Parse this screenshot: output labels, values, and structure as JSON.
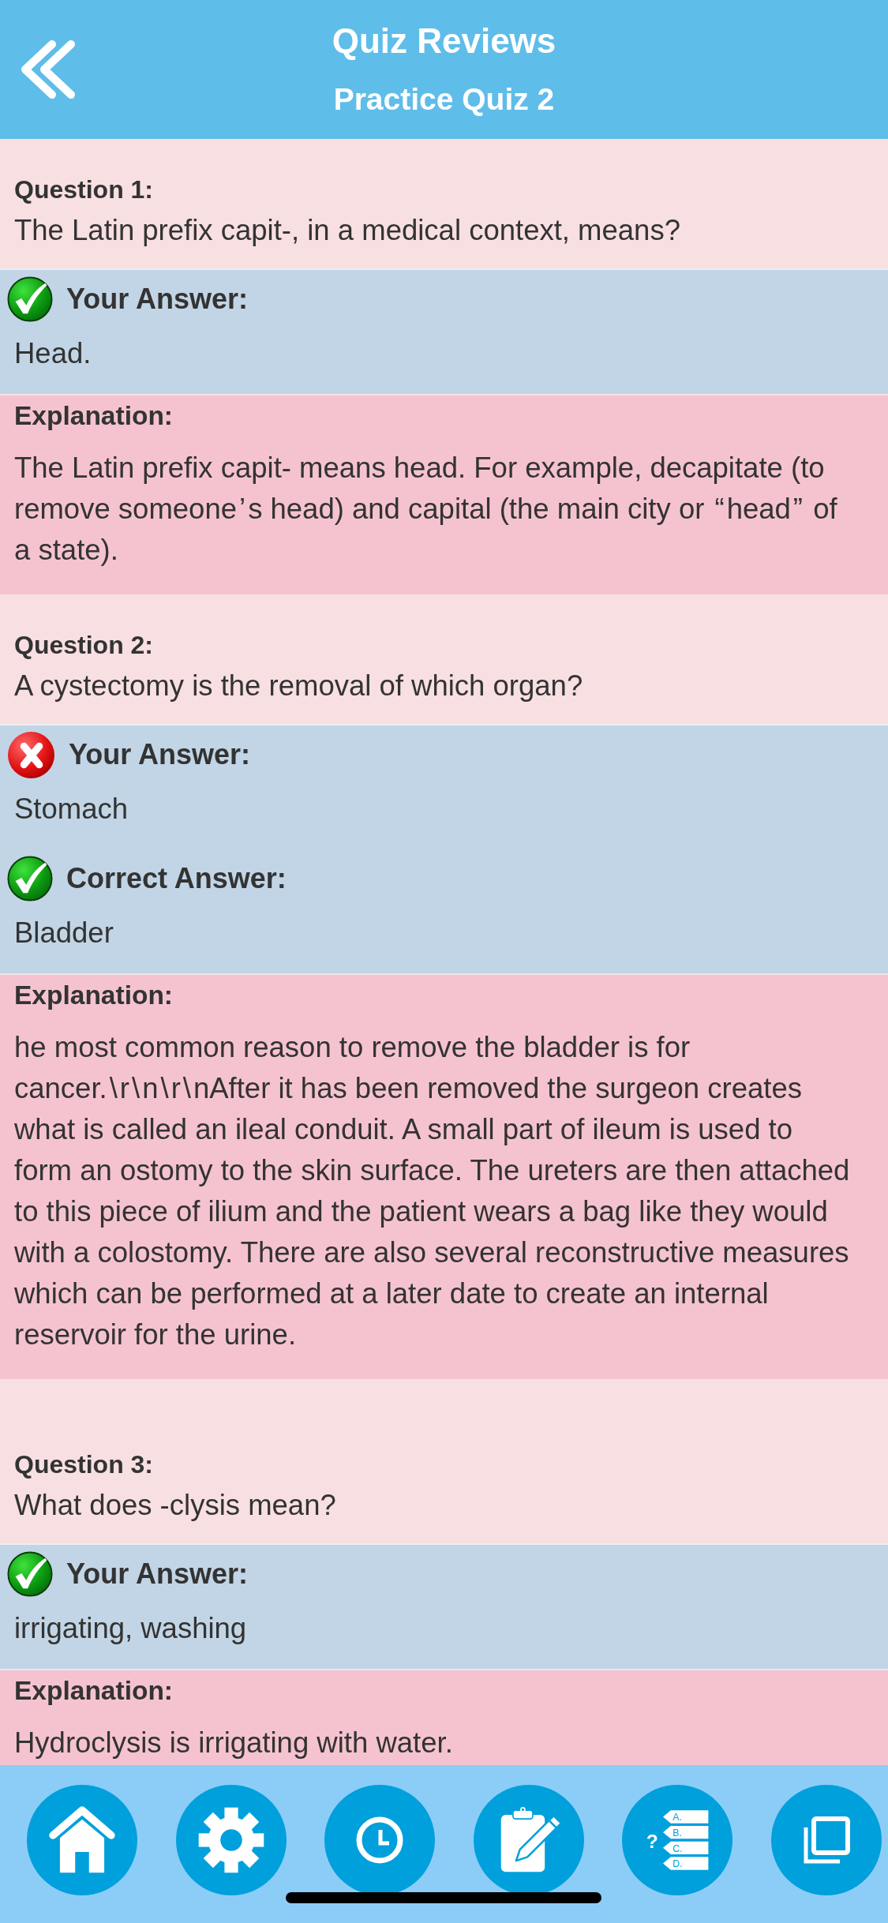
{
  "header": {
    "title": "Quiz Reviews",
    "subtitle": "Practice Quiz 2"
  },
  "questions": [
    {
      "label": "Question 1:",
      "text": "The Latin prefix capit-, in a medical context, means?",
      "answers": [
        {
          "kind": "correct",
          "label": "Your Answer:",
          "value": "Head."
        }
      ],
      "explanation": {
        "label": "Explanation:",
        "text": "The Latin prefix capit- means head. For example, decapitate (to remove someone’s head) and capital (the main city or “head” of a state)."
      }
    },
    {
      "label": "Question 2:",
      "text": "A cystectomy is the removal of which organ?",
      "answers": [
        {
          "kind": "wrong",
          "label": "Your Answer:",
          "value": "Stomach"
        },
        {
          "kind": "correct",
          "label": "Correct Answer:",
          "value": "Bladder"
        }
      ],
      "explanation": {
        "label": "Explanation:",
        "text": "he most common reason to remove the bladder is for cancer.\\r\\n\\r\\nAfter it has been removed the surgeon creates what is called an ileal conduit. A small part of ileum is used to form an ostomy to the skin surface. The ureters are then attached to this piece of ilium and the patient wears a bag like they would with a colostomy. There are also several reconstructive measures which can be performed at a later date to create an internal reservoir for the urine."
      }
    },
    {
      "label": "Question 3:",
      "text": "What does -clysis mean?",
      "answers": [
        {
          "kind": "correct",
          "label": "Your Answer:",
          "value": "irrigating, washing"
        }
      ],
      "explanation": {
        "label": "Explanation:",
        "text": "Hydroclysis is irrigating with water."
      }
    }
  ],
  "nav": [
    {
      "kind": "home"
    },
    {
      "kind": "settings"
    },
    {
      "kind": "clock"
    },
    {
      "kind": "clipboard"
    },
    {
      "kind": "quiz",
      "symbol": "?",
      "options": [
        "A.",
        "B.",
        "C.",
        "D."
      ]
    },
    {
      "kind": "copy"
    }
  ]
}
